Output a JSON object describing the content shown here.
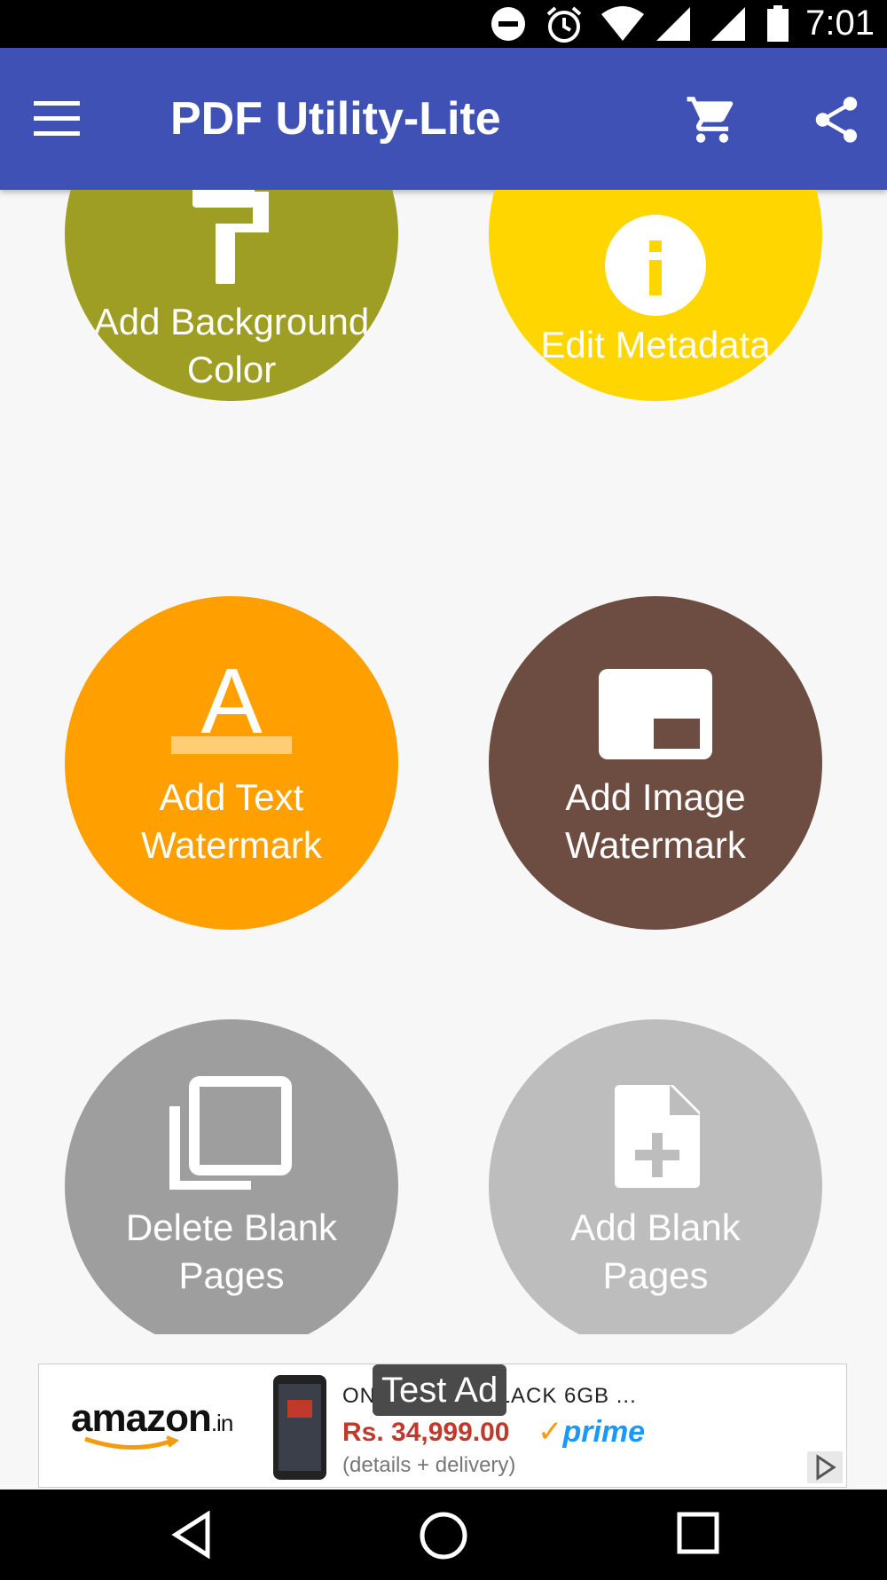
{
  "status_bar": {
    "time": "7:01",
    "icons": [
      "do-not-disturb-icon",
      "alarm-icon",
      "wifi-icon",
      "signal-icon",
      "battery-icon"
    ]
  },
  "app_bar": {
    "title": "PDF Utility-Lite",
    "color": "#3f51b5",
    "icons": [
      "menu-icon",
      "cart-icon",
      "share-icon"
    ]
  },
  "tiles": [
    {
      "label": "Add Background Color",
      "color": "#9e9d24",
      "icon": "paint-roller-icon"
    },
    {
      "label": "Edit Metadata",
      "color": "#ffd600",
      "icon": "info-icon"
    },
    {
      "label": "Add Text Watermark",
      "color": "#ffa000",
      "icon": "text-format-icon"
    },
    {
      "label": "Add Image Watermark",
      "color": "#6d4c41",
      "icon": "picture-in-picture-icon"
    },
    {
      "label": "Delete Blank Pages",
      "color": "#9e9e9e",
      "icon": "copy-pages-icon"
    },
    {
      "label": "Add Blank Pages",
      "color": "#bdbdbd",
      "icon": "note-add-icon"
    }
  ],
  "ad": {
    "badge": "Test Ad",
    "brand": "amazon",
    "brand_suffix": ".in",
    "product": "ON... IRROR BLACK 6GB ...",
    "price": "Rs. 34,999.00",
    "prime_check": "✓",
    "prime": "prime",
    "details": "(details + delivery)"
  },
  "nav_bar": {
    "icons": [
      "back-icon",
      "home-icon",
      "recents-icon"
    ]
  }
}
